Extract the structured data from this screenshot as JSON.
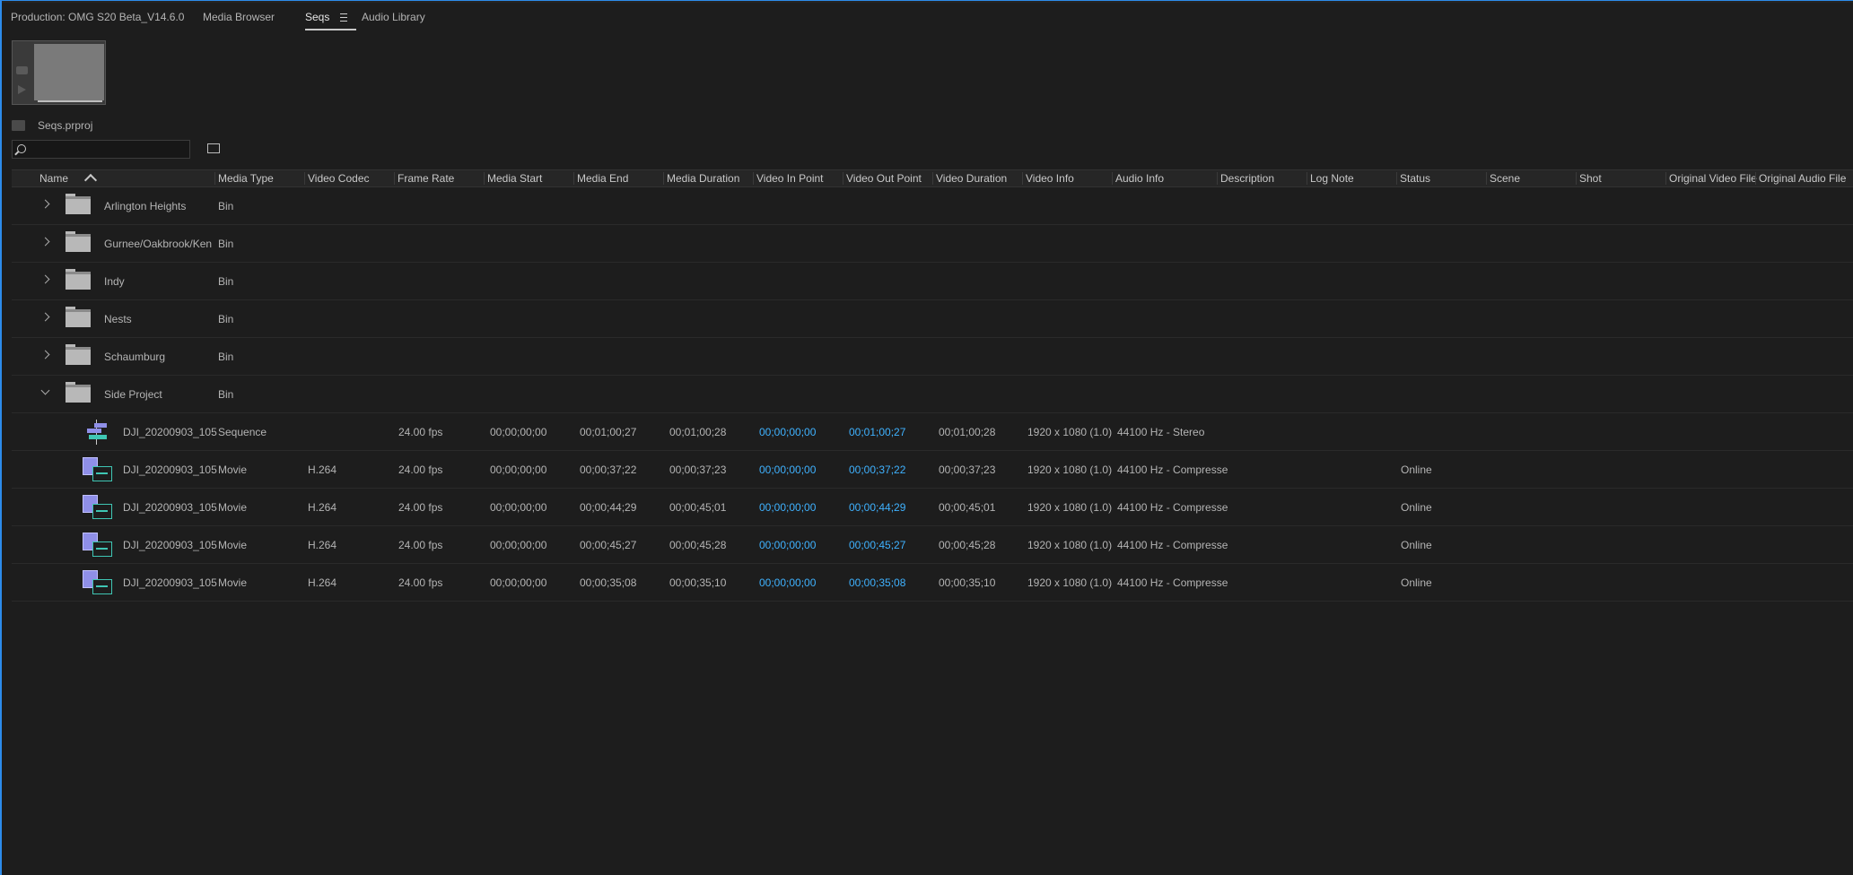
{
  "tabs": [
    {
      "label": "Production: OMG S20 Beta_V14.6.0",
      "active": false
    },
    {
      "label": "Media Browser",
      "active": false
    },
    {
      "label": "Seqs",
      "active": true
    },
    {
      "label": "Audio Library",
      "active": false
    }
  ],
  "tab_menu_icon": "hamburger-menu-icon",
  "project": {
    "name": "Seqs.prproj"
  },
  "search": {
    "value": "",
    "placeholder": ""
  },
  "columns": [
    "Name",
    "Media Type",
    "Video Codec",
    "Frame Rate",
    "Media Start",
    "Media End",
    "Media Duration",
    "Video In Point",
    "Video Out Point",
    "Video Duration",
    "Video Info",
    "Audio Info",
    "Description",
    "Log Note",
    "Status",
    "Scene",
    "Shot",
    "Original Video File",
    "Original Audio File"
  ],
  "rows": [
    {
      "kind": "bin",
      "expanded": false,
      "name": "Arlington Heights",
      "media_type": "Bin"
    },
    {
      "kind": "bin",
      "expanded": false,
      "name": "Gurnee/Oakbrook/Ken",
      "media_type": "Bin"
    },
    {
      "kind": "bin",
      "expanded": false,
      "name": "Indy",
      "media_type": "Bin"
    },
    {
      "kind": "bin",
      "expanded": false,
      "name": "Nests",
      "media_type": "Bin"
    },
    {
      "kind": "bin",
      "expanded": false,
      "name": "Schaumburg",
      "media_type": "Bin"
    },
    {
      "kind": "bin",
      "expanded": true,
      "name": "Side Project",
      "media_type": "Bin"
    },
    {
      "kind": "sequence",
      "name": "DJI_20200903_105",
      "media_type": "Sequence",
      "video_codec": "",
      "frame_rate": "24.00 fps",
      "media_start": "00;00;00;00",
      "media_end": "00;01;00;27",
      "media_duration": "00;01;00;28",
      "video_in": "00;00;00;00",
      "video_out": "00;01;00;27",
      "video_duration": "00;01;00;28",
      "video_info": "1920 x 1080 (1.0)",
      "audio_info": "44100 Hz - Stereo",
      "status": ""
    },
    {
      "kind": "movie",
      "name": "DJI_20200903_105",
      "media_type": "Movie",
      "video_codec": "H.264",
      "frame_rate": "24.00 fps",
      "media_start": "00;00;00;00",
      "media_end": "00;00;37;22",
      "media_duration": "00;00;37;23",
      "video_in": "00;00;00;00",
      "video_out": "00;00;37;22",
      "video_duration": "00;00;37;23",
      "video_info": "1920 x 1080 (1.0)",
      "audio_info": "44100 Hz - Compresse",
      "status": "Online"
    },
    {
      "kind": "movie",
      "name": "DJI_20200903_105",
      "media_type": "Movie",
      "video_codec": "H.264",
      "frame_rate": "24.00 fps",
      "media_start": "00;00;00;00",
      "media_end": "00;00;44;29",
      "media_duration": "00;00;45;01",
      "video_in": "00;00;00;00",
      "video_out": "00;00;44;29",
      "video_duration": "00;00;45;01",
      "video_info": "1920 x 1080 (1.0)",
      "audio_info": "44100 Hz - Compresse",
      "status": "Online"
    },
    {
      "kind": "movie",
      "name": "DJI_20200903_105",
      "media_type": "Movie",
      "video_codec": "H.264",
      "frame_rate": "24.00 fps",
      "media_start": "00;00;00;00",
      "media_end": "00;00;45;27",
      "media_duration": "00;00;45;28",
      "video_in": "00;00;00;00",
      "video_out": "00;00;45;27",
      "video_duration": "00;00;45;28",
      "video_info": "1920 x 1080 (1.0)",
      "audio_info": "44100 Hz - Compresse",
      "status": "Online"
    },
    {
      "kind": "movie",
      "name": "DJI_20200903_105",
      "media_type": "Movie",
      "video_codec": "H.264",
      "frame_rate": "24.00 fps",
      "media_start": "00;00;00;00",
      "media_end": "00;00;35;08",
      "media_duration": "00;00;35;10",
      "video_in": "00;00;00;00",
      "video_out": "00;00;35;08",
      "video_duration": "00;00;35;10",
      "video_info": "1920 x 1080 (1.0)",
      "audio_info": "44100 Hz - Compresse",
      "status": "Online"
    }
  ],
  "colors": {
    "accent": "#2d8ceb",
    "timecode_blue": "#3fb2ff",
    "video_purple": "#8f8fe8",
    "audio_teal": "#3fc6b4",
    "background": "#1d1d1d"
  }
}
